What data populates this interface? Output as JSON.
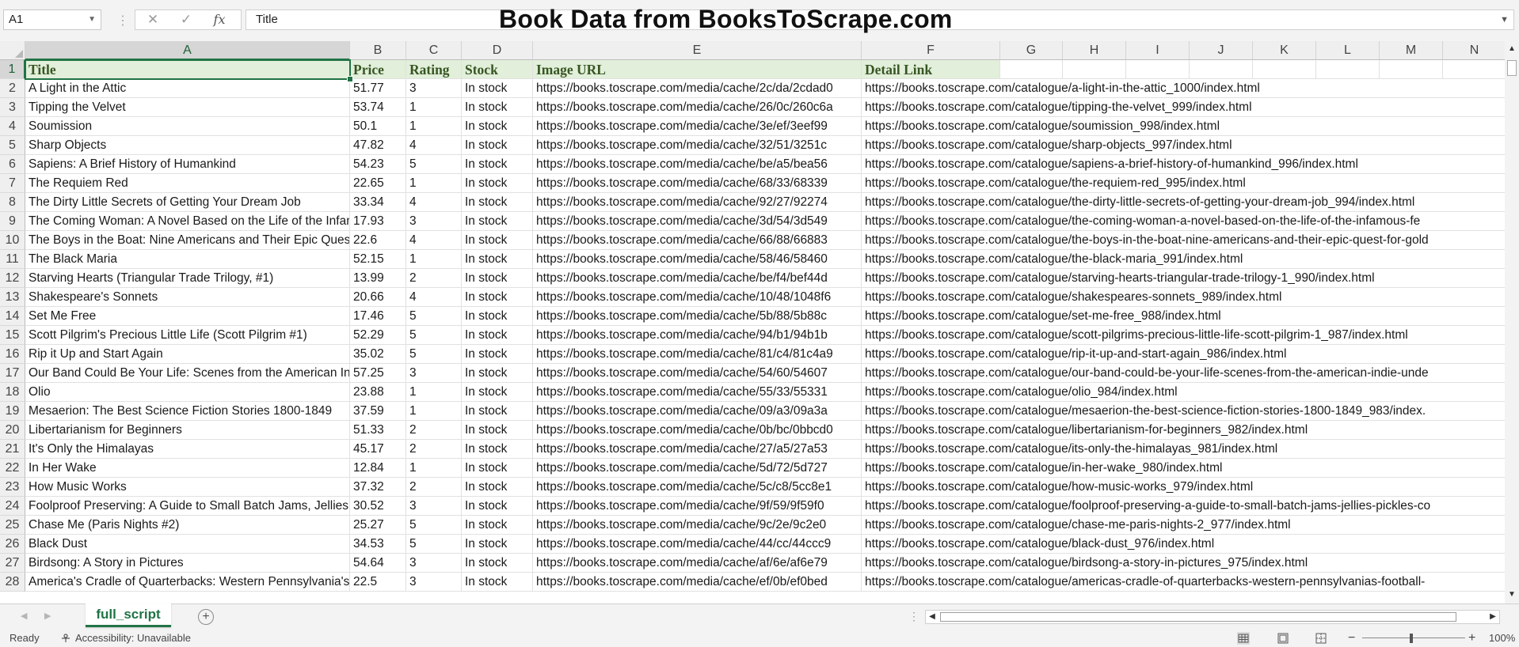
{
  "formula_bar": {
    "name_box": "A1",
    "formula": "Title",
    "cancel_icon": "✕",
    "enter_icon": "✓",
    "function_label": "fx"
  },
  "sheet_title": "Book Data from BooksToScrape.com",
  "columns": [
    "A",
    "B",
    "C",
    "D",
    "E",
    "F",
    "G",
    "H",
    "I",
    "J",
    "K",
    "L",
    "M",
    "N"
  ],
  "header_row": {
    "title": "Title",
    "price": "Price",
    "rating": "Rating",
    "stock": "Stock",
    "image_url": "Image URL",
    "detail_link": "Detail Link"
  },
  "rows": [
    {
      "n": "2",
      "title": "A Light in the Attic",
      "price": "51.77",
      "rating": "3",
      "stock": "In stock",
      "image": "https://books.toscrape.com/media/cache/2c/da/2cdad0",
      "link": "https://books.toscrape.com/catalogue/a-light-in-the-attic_1000/index.html"
    },
    {
      "n": "3",
      "title": "Tipping the Velvet",
      "price": "53.74",
      "rating": "1",
      "stock": "In stock",
      "image": "https://books.toscrape.com/media/cache/26/0c/260c6a",
      "link": "https://books.toscrape.com/catalogue/tipping-the-velvet_999/index.html"
    },
    {
      "n": "4",
      "title": "Soumission",
      "price": "50.1",
      "rating": "1",
      "stock": "In stock",
      "image": "https://books.toscrape.com/media/cache/3e/ef/3eef99",
      "link": "https://books.toscrape.com/catalogue/soumission_998/index.html"
    },
    {
      "n": "5",
      "title": "Sharp Objects",
      "price": "47.82",
      "rating": "4",
      "stock": "In stock",
      "image": "https://books.toscrape.com/media/cache/32/51/3251c",
      "link": "https://books.toscrape.com/catalogue/sharp-objects_997/index.html"
    },
    {
      "n": "6",
      "title": "Sapiens: A Brief History of Humankind",
      "price": "54.23",
      "rating": "5",
      "stock": "In stock",
      "image": "https://books.toscrape.com/media/cache/be/a5/bea56",
      "link": "https://books.toscrape.com/catalogue/sapiens-a-brief-history-of-humankind_996/index.html"
    },
    {
      "n": "7",
      "title": "The Requiem Red",
      "price": "22.65",
      "rating": "1",
      "stock": "In stock",
      "image": "https://books.toscrape.com/media/cache/68/33/68339",
      "link": "https://books.toscrape.com/catalogue/the-requiem-red_995/index.html"
    },
    {
      "n": "8",
      "title": "The Dirty Little Secrets of Getting Your Dream Job",
      "price": "33.34",
      "rating": "4",
      "stock": "In stock",
      "image": "https://books.toscrape.com/media/cache/92/27/92274",
      "link": "https://books.toscrape.com/catalogue/the-dirty-little-secrets-of-getting-your-dream-job_994/index.html"
    },
    {
      "n": "9",
      "title": "The Coming Woman: A Novel Based on the Life of the Infamous Feminist, Victoria Woodhull",
      "price": "17.93",
      "rating": "3",
      "stock": "In stock",
      "image": "https://books.toscrape.com/media/cache/3d/54/3d549",
      "link": "https://books.toscrape.com/catalogue/the-coming-woman-a-novel-based-on-the-life-of-the-infamous-fe"
    },
    {
      "n": "10",
      "title": "The Boys in the Boat: Nine Americans and Their Epic Quest for Gold",
      "price": "22.6",
      "rating": "4",
      "stock": "In stock",
      "image": "https://books.toscrape.com/media/cache/66/88/66883",
      "link": "https://books.toscrape.com/catalogue/the-boys-in-the-boat-nine-americans-and-their-epic-quest-for-gold"
    },
    {
      "n": "11",
      "title": "The Black Maria",
      "price": "52.15",
      "rating": "1",
      "stock": "In stock",
      "image": "https://books.toscrape.com/media/cache/58/46/58460",
      "link": "https://books.toscrape.com/catalogue/the-black-maria_991/index.html"
    },
    {
      "n": "12",
      "title": "Starving Hearts (Triangular Trade Trilogy, #1)",
      "price": "13.99",
      "rating": "2",
      "stock": "In stock",
      "image": "https://books.toscrape.com/media/cache/be/f4/bef44d",
      "link": "https://books.toscrape.com/catalogue/starving-hearts-triangular-trade-trilogy-1_990/index.html"
    },
    {
      "n": "13",
      "title": "Shakespeare's Sonnets",
      "price": "20.66",
      "rating": "4",
      "stock": "In stock",
      "image": "https://books.toscrape.com/media/cache/10/48/1048f6",
      "link": "https://books.toscrape.com/catalogue/shakespeares-sonnets_989/index.html"
    },
    {
      "n": "14",
      "title": "Set Me Free",
      "price": "17.46",
      "rating": "5",
      "stock": "In stock",
      "image": "https://books.toscrape.com/media/cache/5b/88/5b88c",
      "link": "https://books.toscrape.com/catalogue/set-me-free_988/index.html"
    },
    {
      "n": "15",
      "title": "Scott Pilgrim's Precious Little Life (Scott Pilgrim #1)",
      "price": "52.29",
      "rating": "5",
      "stock": "In stock",
      "image": "https://books.toscrape.com/media/cache/94/b1/94b1b",
      "link": "https://books.toscrape.com/catalogue/scott-pilgrims-precious-little-life-scott-pilgrim-1_987/index.html"
    },
    {
      "n": "16",
      "title": "Rip it Up and Start Again",
      "price": "35.02",
      "rating": "5",
      "stock": "In stock",
      "image": "https://books.toscrape.com/media/cache/81/c4/81c4a9",
      "link": "https://books.toscrape.com/catalogue/rip-it-up-and-start-again_986/index.html"
    },
    {
      "n": "17",
      "title": "Our Band Could Be Your Life: Scenes from the American Indie Underground",
      "price": "57.25",
      "rating": "3",
      "stock": "In stock",
      "image": "https://books.toscrape.com/media/cache/54/60/54607",
      "link": "https://books.toscrape.com/catalogue/our-band-could-be-your-life-scenes-from-the-american-indie-unde"
    },
    {
      "n": "18",
      "title": "Olio",
      "price": "23.88",
      "rating": "1",
      "stock": "In stock",
      "image": "https://books.toscrape.com/media/cache/55/33/55331",
      "link": "https://books.toscrape.com/catalogue/olio_984/index.html"
    },
    {
      "n": "19",
      "title": "Mesaerion: The Best Science Fiction Stories 1800-1849",
      "price": "37.59",
      "rating": "1",
      "stock": "In stock",
      "image": "https://books.toscrape.com/media/cache/09/a3/09a3a",
      "link": "https://books.toscrape.com/catalogue/mesaerion-the-best-science-fiction-stories-1800-1849_983/index."
    },
    {
      "n": "20",
      "title": "Libertarianism for Beginners",
      "price": "51.33",
      "rating": "2",
      "stock": "In stock",
      "image": "https://books.toscrape.com/media/cache/0b/bc/0bbcd0",
      "link": "https://books.toscrape.com/catalogue/libertarianism-for-beginners_982/index.html"
    },
    {
      "n": "21",
      "title": "It's Only the Himalayas",
      "price": "45.17",
      "rating": "2",
      "stock": "In stock",
      "image": "https://books.toscrape.com/media/cache/27/a5/27a53",
      "link": "https://books.toscrape.com/catalogue/its-only-the-himalayas_981/index.html"
    },
    {
      "n": "22",
      "title": "In Her Wake",
      "price": "12.84",
      "rating": "1",
      "stock": "In stock",
      "image": "https://books.toscrape.com/media/cache/5d/72/5d727",
      "link": "https://books.toscrape.com/catalogue/in-her-wake_980/index.html"
    },
    {
      "n": "23",
      "title": "How Music Works",
      "price": "37.32",
      "rating": "2",
      "stock": "In stock",
      "image": "https://books.toscrape.com/media/cache/5c/c8/5cc8e1",
      "link": "https://books.toscrape.com/catalogue/how-music-works_979/index.html"
    },
    {
      "n": "24",
      "title": "Foolproof Preserving: A Guide to Small Batch Jams, Jellies, Pickles, Condiments, and More",
      "price": "30.52",
      "rating": "3",
      "stock": "In stock",
      "image": "https://books.toscrape.com/media/cache/9f/59/9f59f0",
      "link": "https://books.toscrape.com/catalogue/foolproof-preserving-a-guide-to-small-batch-jams-jellies-pickles-co"
    },
    {
      "n": "25",
      "title": "Chase Me (Paris Nights #2)",
      "price": "25.27",
      "rating": "5",
      "stock": "In stock",
      "image": "https://books.toscrape.com/media/cache/9c/2e/9c2e0",
      "link": "https://books.toscrape.com/catalogue/chase-me-paris-nights-2_977/index.html"
    },
    {
      "n": "26",
      "title": "Black Dust",
      "price": "34.53",
      "rating": "5",
      "stock": "In stock",
      "image": "https://books.toscrape.com/media/cache/44/cc/44ccc9",
      "link": "https://books.toscrape.com/catalogue/black-dust_976/index.html"
    },
    {
      "n": "27",
      "title": "Birdsong: A Story in Pictures",
      "price": "54.64",
      "rating": "3",
      "stock": "In stock",
      "image": "https://books.toscrape.com/media/cache/af/6e/af6e79",
      "link": "https://books.toscrape.com/catalogue/birdsong-a-story-in-pictures_975/index.html"
    },
    {
      "n": "28",
      "title": "America's Cradle of Quarterbacks: Western Pennsylvania's Football Factory",
      "price": "22.5",
      "rating": "3",
      "stock": "In stock",
      "image": "https://books.toscrape.com/media/cache/ef/0b/ef0bed",
      "link": "https://books.toscrape.com/catalogue/americas-cradle-of-quarterbacks-western-pennsylvanias-football-"
    }
  ],
  "sheet_tabs": {
    "active": "full_script",
    "add_icon": "+"
  },
  "status_bar": {
    "ready": "Ready",
    "accessibility": "Accessibility: Unavailable",
    "zoom": "100%"
  },
  "colors": {
    "accent": "#217346",
    "header_fill": "#e2efda",
    "header_text": "#375623"
  }
}
